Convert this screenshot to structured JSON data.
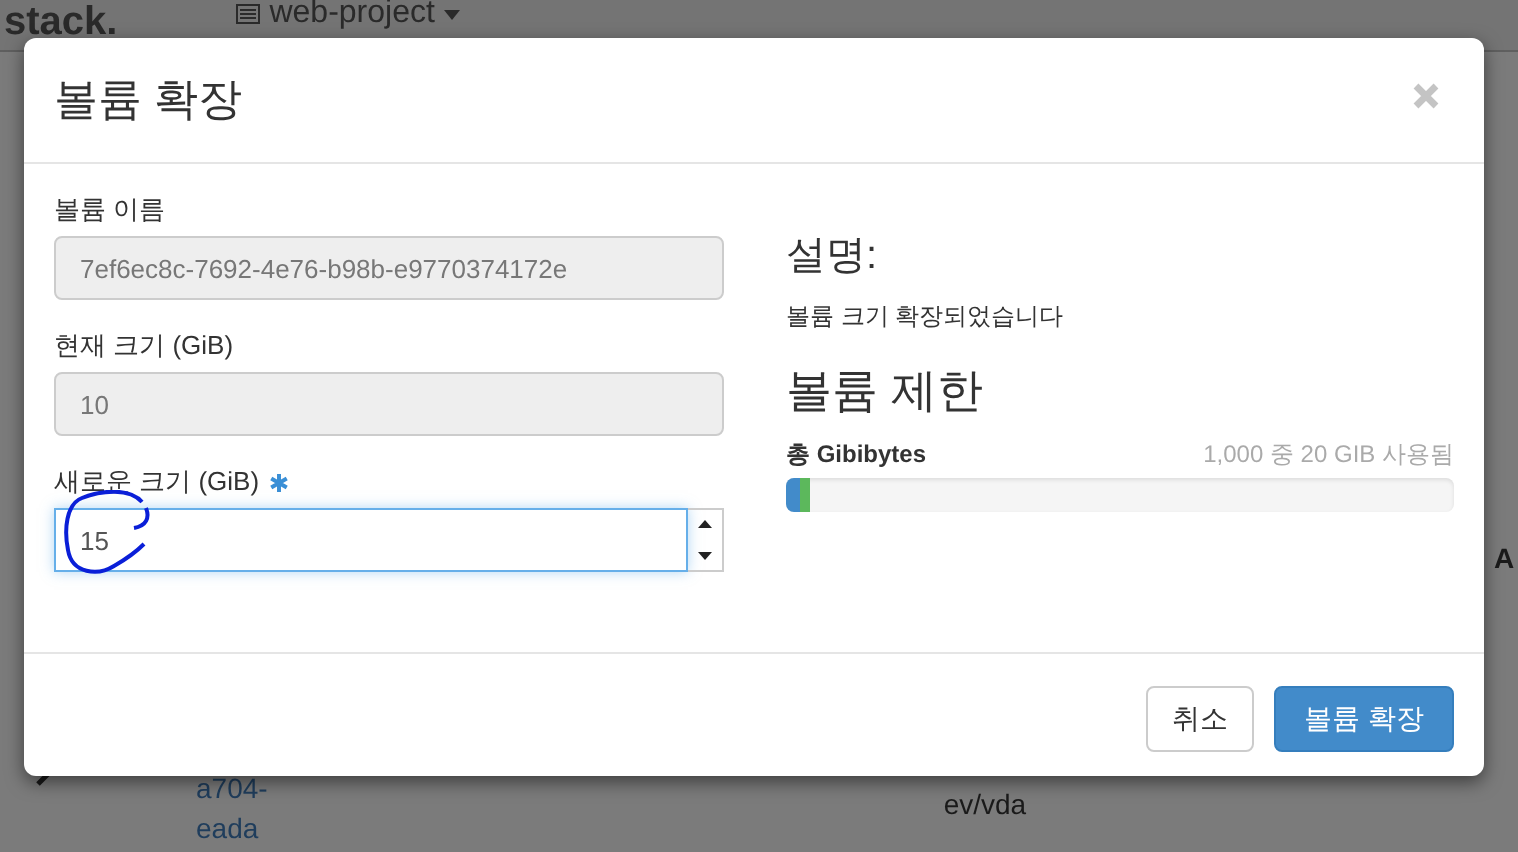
{
  "background": {
    "logo": "stack.",
    "project": "web-project",
    "row_id_lines": [
      "a704-",
      "eada"
    ],
    "row_device": "ev/vda",
    "column_edge": "A"
  },
  "dialog": {
    "title": "볼륨 확장",
    "fields": [
      {
        "label": "볼륨 이름",
        "value": "7ef6ec8c-7692-4e76-b98b-e9770374172e",
        "disabled": true,
        "required": false,
        "kind": "text"
      },
      {
        "label": "현재 크기 (GiB)",
        "value": "10",
        "disabled": true,
        "required": false,
        "kind": "text"
      },
      {
        "label": "새로운 크기 (GiB)",
        "value": "15",
        "disabled": false,
        "required": true,
        "kind": "number"
      }
    ],
    "description": {
      "heading": "설명:",
      "text": "볼륨 크기 확장되었습니다"
    },
    "limits": {
      "heading": "볼륨 제한",
      "label": "총 Gibibytes",
      "usage": "1,000 중 20 GIB 사용됨",
      "segments": [
        {
          "level": 0.02,
          "color": "#428bca"
        },
        {
          "level": 0.015,
          "color": "#5cb85c"
        }
      ]
    },
    "buttons": [
      {
        "label": "취소",
        "kind": "default"
      },
      {
        "label": "볼륨 확장",
        "kind": "primary"
      }
    ]
  }
}
